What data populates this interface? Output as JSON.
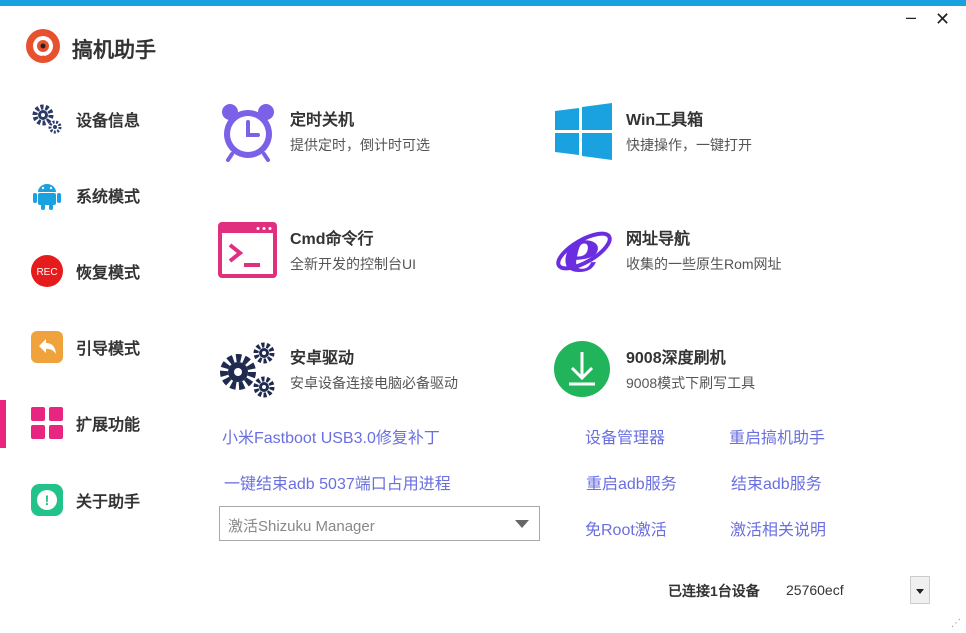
{
  "window": {
    "title": "搞机助手",
    "minimize_glyph": "–",
    "close_glyph": "✕",
    "accent": "#1aa1e0"
  },
  "sidebar": {
    "active_color": "#e9267f",
    "items": [
      {
        "label": "设备信息",
        "icon": "gears-icon"
      },
      {
        "label": "系统模式",
        "icon": "android-icon"
      },
      {
        "label": "恢复模式",
        "icon": "rec-icon",
        "icon_text": "REC"
      },
      {
        "label": "引导模式",
        "icon": "back-arrow-icon"
      },
      {
        "label": "扩展功能",
        "icon": "grid-icon",
        "active": true
      },
      {
        "label": "关于助手",
        "icon": "info-icon",
        "icon_text": "!"
      }
    ]
  },
  "tools": [
    {
      "title": "定时关机",
      "desc": "提供定时，倒计时可选",
      "icon": "alarm-clock-icon"
    },
    {
      "title": "Win工具箱",
      "desc": "快捷操作，一键打开",
      "icon": "windows-logo-icon"
    },
    {
      "title": "Cmd命令行",
      "desc": "全新开发的控制台UI",
      "icon": "terminal-icon"
    },
    {
      "title": "网址导航",
      "desc": "收集的一些原生Rom网址",
      "icon": "ie-browser-icon"
    },
    {
      "title": "安卓驱动",
      "desc": "安卓设备连接电脑必备驱动",
      "icon": "driver-gears-icon"
    },
    {
      "title": "9008深度刷机",
      "desc": "9008模式下刷写工具",
      "icon": "download-flash-icon"
    }
  ],
  "links": {
    "mi_fastboot_patch": "小米Fastboot USB3.0修复补丁",
    "kill_adb_5037": "一键结束adb 5037端口占用进程",
    "device_manager": "设备管理器",
    "restart_assistant": "重启搞机助手",
    "restart_adb": "重启adb服务",
    "kill_adb": "结束adb服务",
    "rootless_activate": "免Root激活",
    "activate_help": "激活相关说明"
  },
  "shizuku_combo": {
    "selected": "激活Shizuku Manager"
  },
  "status": {
    "connected_label": "已连接1台设备",
    "device_id": "25760ecf"
  }
}
